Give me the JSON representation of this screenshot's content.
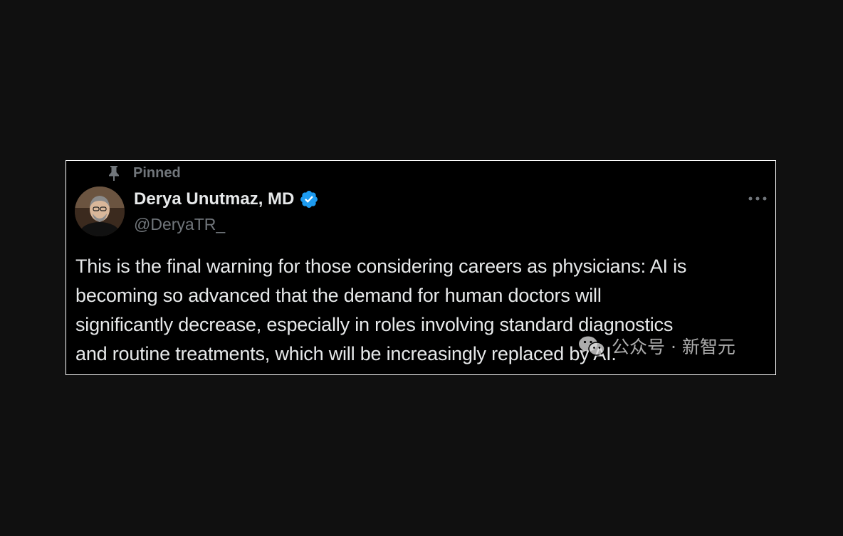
{
  "tweet": {
    "pinned_label": "Pinned",
    "author_name": "Derya Unutmaz, MD",
    "author_handle": "@DeryaTR_",
    "text_lines": [
      "This is the final warning for those considering careers as physicians: AI is",
      "becoming so advanced that the demand for human doctors will",
      "significantly decrease, especially in roles involving standard diagnostics",
      "and routine treatments, which will be increasingly replaced by AI."
    ]
  },
  "watermark": {
    "text": "公众号 · 新智元",
    "icon": "wechat-icon"
  },
  "icons": {
    "pin": "pin-icon",
    "verified": "verified-badge-icon",
    "more": "more-options-icon"
  },
  "colors": {
    "background": "#101010",
    "card": "#000000",
    "text_primary": "#e7e9ea",
    "text_secondary": "#71767b",
    "verified_blue": "#1d9bf0"
  }
}
